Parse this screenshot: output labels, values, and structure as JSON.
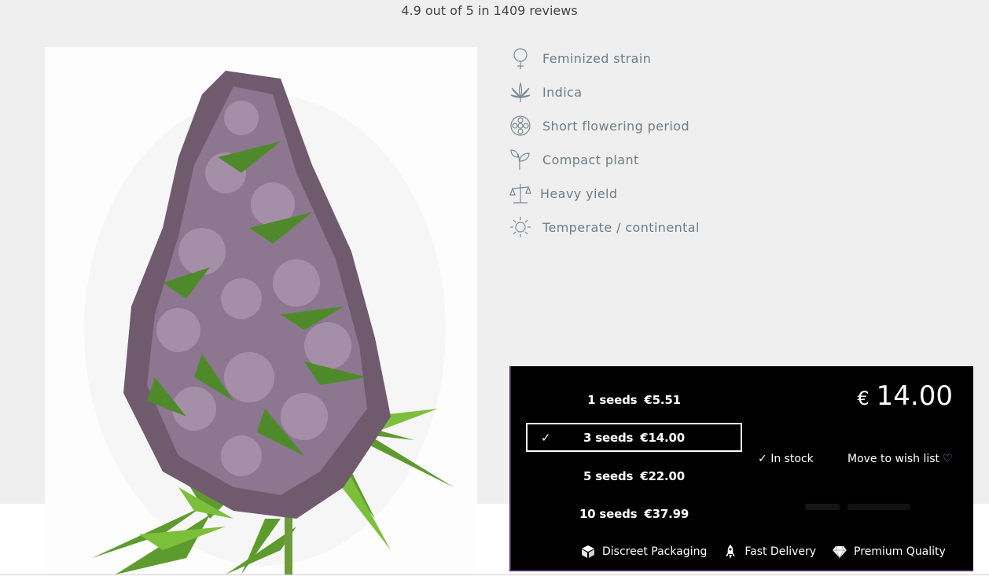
{
  "rating": {
    "text": "4.9 out of 5 in 1409 reviews"
  },
  "product": {
    "image_icon": "cannabis-bud-photo"
  },
  "features": [
    {
      "icon": "female-symbol-icon",
      "label": "Feminized strain"
    },
    {
      "icon": "cannabis-leaf-icon",
      "label": "Indica"
    },
    {
      "icon": "flower-timer-icon",
      "label": "Short flowering period"
    },
    {
      "icon": "sprout-icon",
      "label": "Compact plant"
    },
    {
      "icon": "scale-icon",
      "label": "Heavy yield"
    },
    {
      "icon": "sun-icon",
      "label": "Temperate / continental"
    }
  ],
  "packs": [
    {
      "label": "1 seeds",
      "price": "€5.51",
      "selected": false
    },
    {
      "label": "3 seeds",
      "price": "€14.00",
      "selected": true
    },
    {
      "label": "5 seeds",
      "price": "€22.00",
      "selected": false
    },
    {
      "label": "10 seeds",
      "price": "€37.99",
      "selected": false
    }
  ],
  "price": {
    "currency": "€",
    "amount": "14.00"
  },
  "stock": {
    "label": "In stock",
    "icon": "check-icon"
  },
  "wishlist": {
    "label": "Move to wish list",
    "icon": "heart-icon"
  },
  "perks": [
    {
      "icon": "box-icon",
      "label": "Discreet Packaging"
    },
    {
      "icon": "rocket-icon",
      "label": "Fast Delivery"
    },
    {
      "icon": "diamond-icon",
      "label": "Premium Quality"
    }
  ],
  "colors": {
    "panel_bg": "#000000",
    "panel_border": "#4c2d5c",
    "feature_text": "#6f7d85",
    "accent_purple": "#b98fd6"
  }
}
